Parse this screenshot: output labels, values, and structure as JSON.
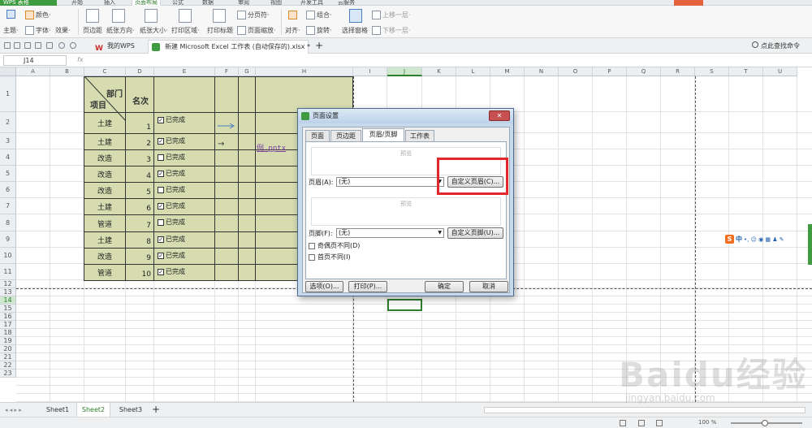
{
  "app": {
    "logo": "WPS 表格"
  },
  "menu": [
    "开始",
    "插入",
    "页面布局",
    "公式",
    "数据",
    "审阅",
    "视图",
    "开发工具",
    "云服务"
  ],
  "ribbon": {
    "theme": "主题·",
    "colors": "颜色·",
    "fonts": "字体·",
    "effects": "效果·",
    "margins": "页边距",
    "orientation": "纸张方向·",
    "size": "纸张大小·",
    "print_area": "打印区域·",
    "print_titles": "打印标题",
    "page_break": "分页符·",
    "page_zoom": "页面缩放·",
    "align": "对齐·",
    "group": "组合·",
    "rotate": "旋转·",
    "selection_pane": "选择窗格",
    "bring_forward": "上移一层·",
    "send_backward": "下移一层·"
  },
  "tabs": {
    "mywps": "我的WPS",
    "document": "新建 Microsoft Excel 工作表 (自动保存的).xlsx *",
    "add": "+",
    "search": "点此查找命令"
  },
  "formula": {
    "cell_ref": "J14",
    "fx": "fx"
  },
  "columns": [
    "A",
    "B",
    "C",
    "D",
    "E",
    "F",
    "G",
    "H",
    "I",
    "J",
    "K",
    "L",
    "M",
    "N",
    "O",
    "P",
    "Q",
    "R",
    "S",
    "T",
    "U"
  ],
  "rows": [
    "1",
    "2",
    "3",
    "4",
    "5",
    "6",
    "7",
    "8",
    "9",
    "10",
    "11",
    "12",
    "13",
    "14",
    "15",
    "16",
    "17",
    "18",
    "19",
    "20",
    "21",
    "22",
    "23"
  ],
  "table": {
    "header_dept": "部门",
    "header_item": "项目",
    "header_rank": "名次",
    "rows": [
      {
        "dept": "土建",
        "rank": "1",
        "done": "已完成",
        "checked": true
      },
      {
        "dept": "土建",
        "rank": "2",
        "done": "已完成",
        "checked": true
      },
      {
        "dept": "改造",
        "rank": "3",
        "done": "已完成",
        "checked": false
      },
      {
        "dept": "改造",
        "rank": "4",
        "done": "已完成",
        "checked": true
      },
      {
        "dept": "改造",
        "rank": "5",
        "done": "已完成",
        "checked": false
      },
      {
        "dept": "土建",
        "rank": "6",
        "done": "已完成",
        "checked": true
      },
      {
        "dept": "管道",
        "rank": "7",
        "done": "已完成",
        "checked": false
      },
      {
        "dept": "土建",
        "rank": "8",
        "done": "已完成",
        "checked": true
      },
      {
        "dept": "改造",
        "rank": "9",
        "done": "已完成",
        "checked": true
      },
      {
        "dept": "管道",
        "rank": "10",
        "done": "已完成",
        "checked": true
      }
    ],
    "link": "例.pptx",
    "arrow": "→"
  },
  "sheets": [
    "Sheet1",
    "Sheet2",
    "Sheet3"
  ],
  "status": {
    "zoom": "100 %"
  },
  "dialog": {
    "title": "页面设置",
    "close": "✕",
    "tabs": [
      "页面",
      "页边距",
      "页眉/页脚",
      "工作表"
    ],
    "preview1": "预览",
    "preview2": "预览",
    "header_label": "页眉(A):",
    "header_value": "(无)",
    "custom_header": "自定义页眉(C)...",
    "footer_label": "页脚(F):",
    "footer_value": "(无)",
    "custom_footer": "自定义页脚(U)...",
    "odd_even": "奇偶页不同(D)",
    "first_page": "首页不同(I)",
    "options": "选项(O)...",
    "print": "打印(P)...",
    "ok": "确定",
    "cancel": "取消"
  },
  "ime": {
    "text": "中"
  },
  "watermark": {
    "text": "Baidu经验",
    "url": "jingyan.baidu.com"
  }
}
